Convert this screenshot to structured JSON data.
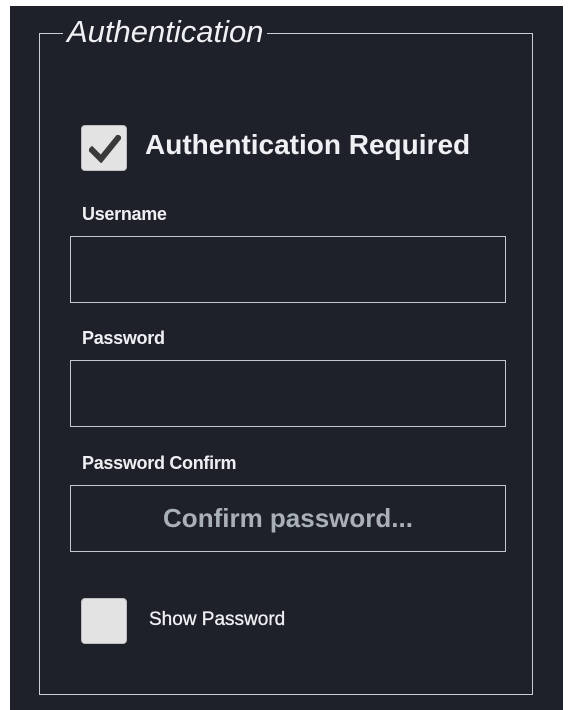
{
  "group": {
    "title": "Authentication"
  },
  "auth_required": {
    "label": "Authentication Required",
    "checked": true
  },
  "username": {
    "label": "Username",
    "value": "",
    "placeholder": ""
  },
  "password": {
    "label": "Password",
    "value": "",
    "placeholder": ""
  },
  "password_confirm": {
    "label": "Password Confirm",
    "value": "",
    "placeholder": "Confirm password..."
  },
  "show_password": {
    "label": "Show Password",
    "checked": false
  },
  "colors": {
    "panel_background": "#1e2129",
    "text": "#eef0f3",
    "border": "#c4c7cd",
    "checkbox_fill": "#e3e3e3",
    "checkmark": "#3a3a3a",
    "placeholder": "#aab0b8"
  },
  "icons": {
    "auth_required_check": "checkmark-icon"
  }
}
